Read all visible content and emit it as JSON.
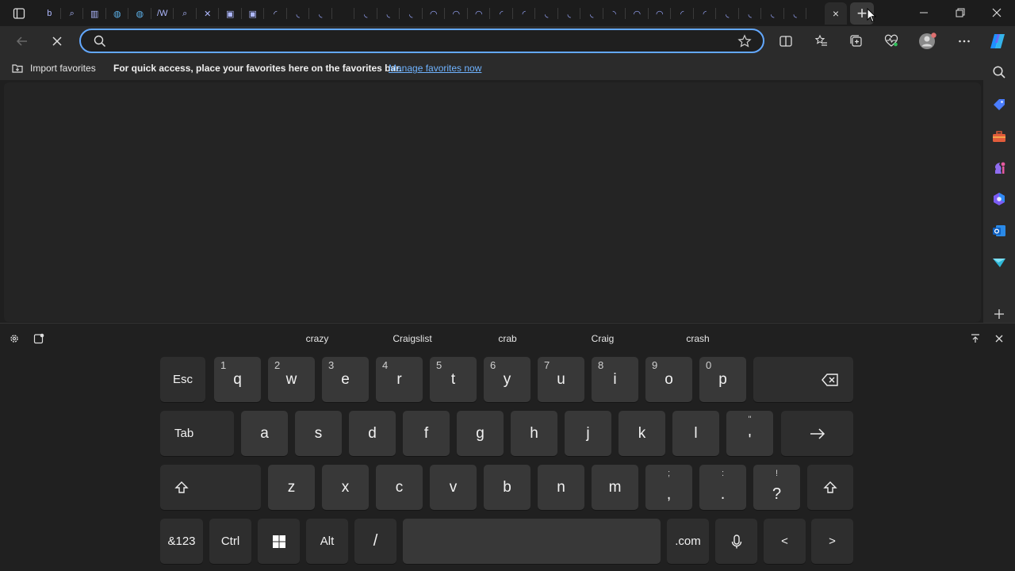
{
  "browser": {
    "active_tab_close_icon": "×",
    "new_tab_icon": "+",
    "address": {
      "value": "",
      "placeholder": ""
    }
  },
  "favorites_bar": {
    "import_label": "Import favorites",
    "message": "For quick access, place your favorites here on the favorites bar.",
    "manage_link": "Manage favorites now"
  },
  "colors": {
    "accent": "#63a8ff",
    "link": "#6fb3ff"
  },
  "keyboard": {
    "suggestions": [
      "crazy",
      "Craigslist",
      "crab",
      "Craig",
      "crash"
    ],
    "row1": [
      {
        "label": "Esc"
      },
      {
        "label": "q",
        "num": "1"
      },
      {
        "label": "w",
        "num": "2"
      },
      {
        "label": "e",
        "num": "3"
      },
      {
        "label": "r",
        "num": "4"
      },
      {
        "label": "t",
        "num": "5"
      },
      {
        "label": "y",
        "num": "6"
      },
      {
        "label": "u",
        "num": "7"
      },
      {
        "label": "i",
        "num": "8"
      },
      {
        "label": "o",
        "num": "9"
      },
      {
        "label": "p",
        "num": "0"
      }
    ],
    "row2": [
      {
        "label": "Tab"
      },
      {
        "label": "a"
      },
      {
        "label": "s"
      },
      {
        "label": "d"
      },
      {
        "label": "f"
      },
      {
        "label": "g"
      },
      {
        "label": "h"
      },
      {
        "label": "j"
      },
      {
        "label": "k"
      },
      {
        "label": "l"
      },
      {
        "label": "'",
        "top": "\""
      }
    ],
    "row3": [
      {
        "label": "z"
      },
      {
        "label": "x"
      },
      {
        "label": "c"
      },
      {
        "label": "v"
      },
      {
        "label": "b"
      },
      {
        "label": "n"
      },
      {
        "label": "m"
      },
      {
        "label": ",",
        "top": ";"
      },
      {
        "label": ".",
        "top": ":"
      },
      {
        "label": "?",
        "top": "!"
      }
    ],
    "row4": {
      "sym": "&123",
      "ctrl": "Ctrl",
      "alt": "Alt",
      "slash": "/",
      "dotcom": ".com",
      "left": "<",
      "right": ">"
    }
  }
}
